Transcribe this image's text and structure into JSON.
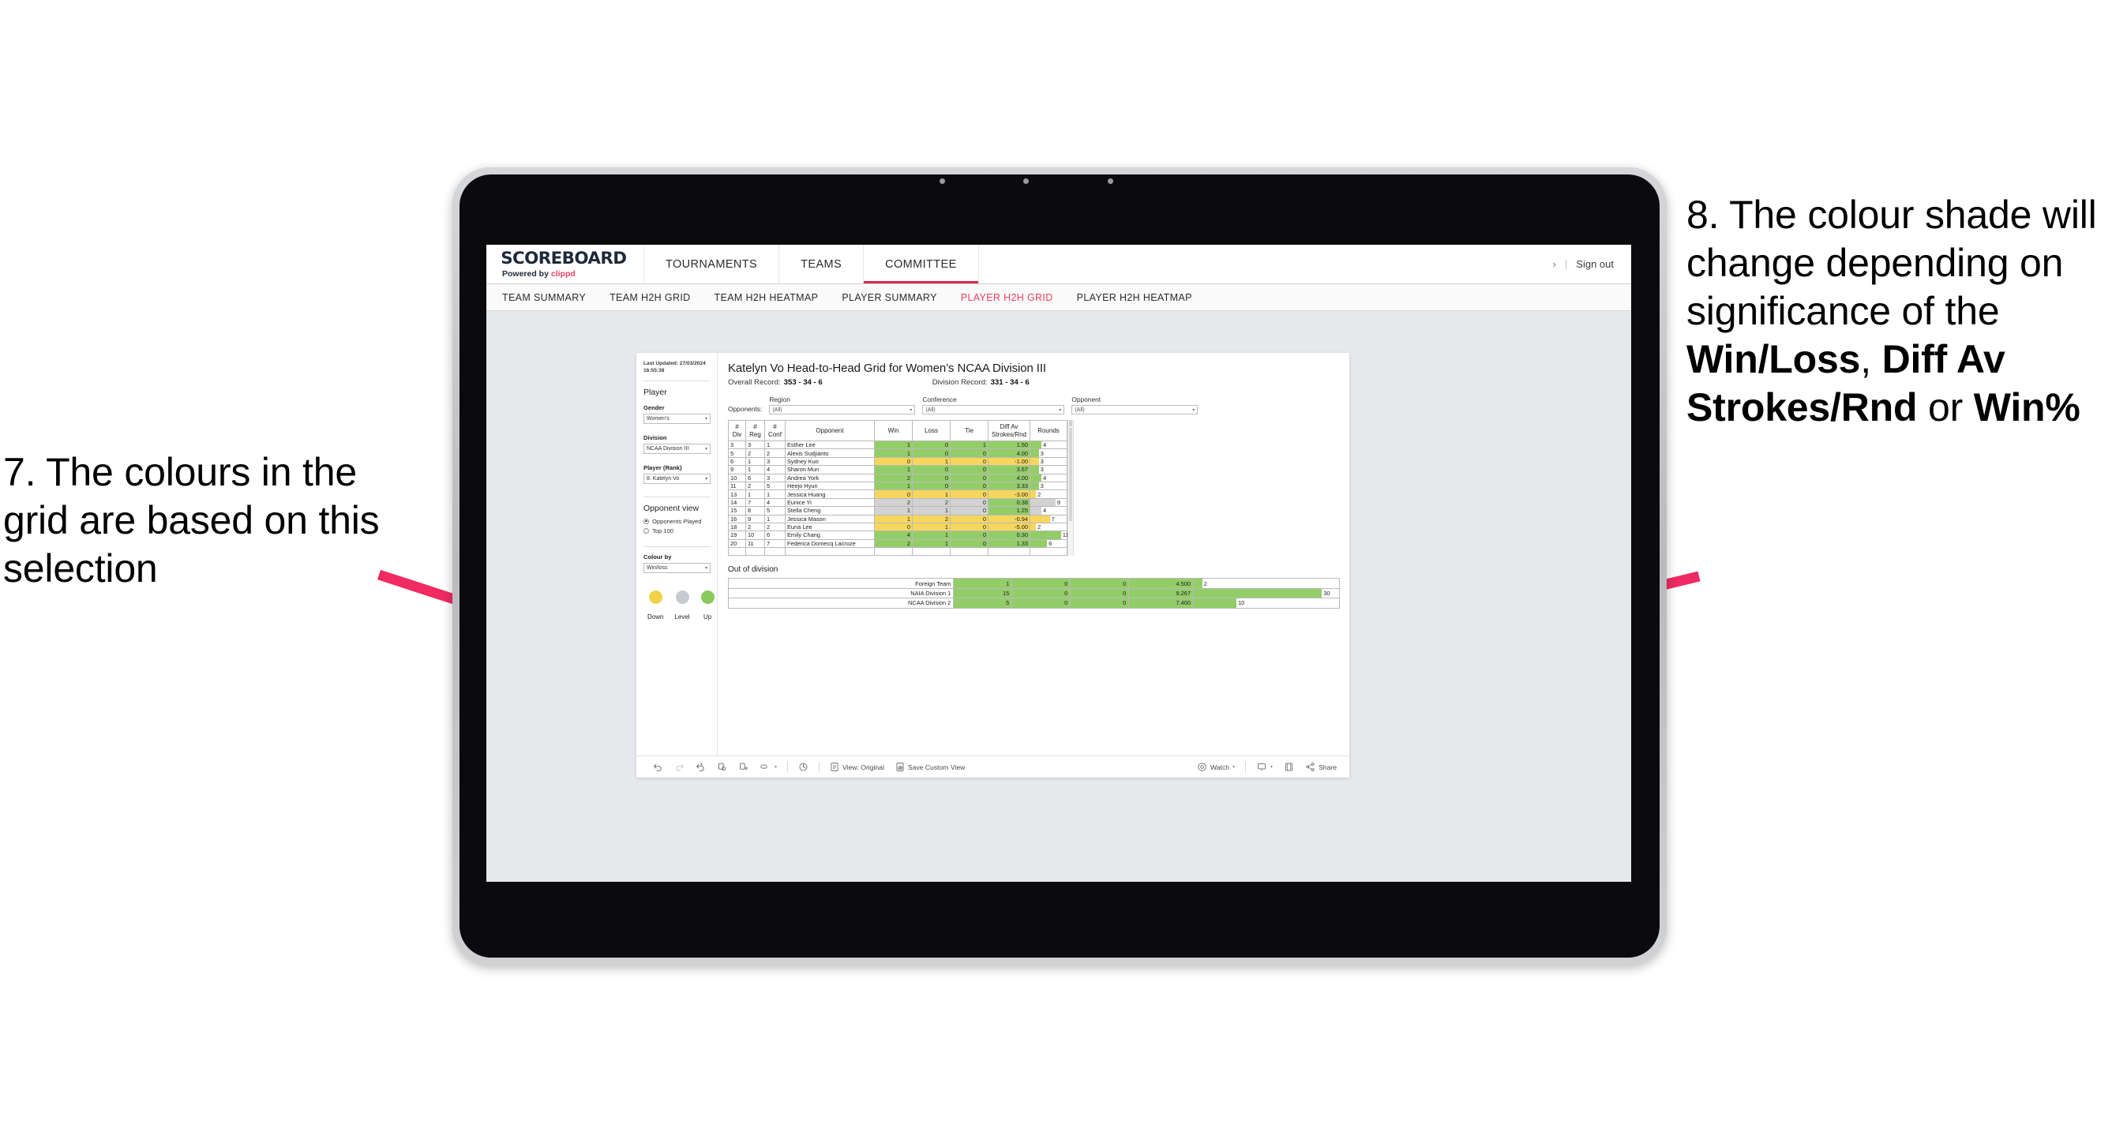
{
  "annotations": {
    "left": "7. The colours in the grid are based on this selection",
    "right_prefix": "8. The colour shade will change depending on significance of the ",
    "right_bold1": "Win/Loss",
    "right_mid1": ", ",
    "right_bold2": "Diff Av Strokes/Rnd",
    "right_mid2": " or ",
    "right_bold3": "Win%",
    "arrow_color": "#ed २१"
  },
  "colors": {
    "accent": "#e8415f",
    "arrow": "#ef2b62",
    "up": "#8bc95a",
    "level": "#c6cbd0",
    "down": "#f2d24b",
    "green_cell": "#93cd68",
    "yellow_cell": "#f6d65c",
    "grey_cell": "#d2d2d2"
  },
  "brand": {
    "title": "SCOREBOARD",
    "powered_prefix": "Powered by ",
    "powered_name": "clippd"
  },
  "topnav": {
    "tabs": [
      {
        "label": "TOURNAMENTS",
        "active": false
      },
      {
        "label": "TEAMS",
        "active": false
      },
      {
        "label": "COMMITTEE",
        "active": true
      }
    ],
    "chevron": "›",
    "divider": "|",
    "signout": "Sign out"
  },
  "subnav": {
    "tabs": [
      {
        "label": "TEAM SUMMARY",
        "active": false
      },
      {
        "label": "TEAM H2H GRID",
        "active": false
      },
      {
        "label": "TEAM H2H HEATMAP",
        "active": false
      },
      {
        "label": "PLAYER SUMMARY",
        "active": false
      },
      {
        "label": "PLAYER H2H GRID",
        "active": true
      },
      {
        "label": "PLAYER H2H HEATMAP",
        "active": false
      }
    ]
  },
  "filters": {
    "last_updated": "Last Updated: 27/03/2024 16:55:38",
    "section_title": "Player",
    "gender": {
      "label": "Gender",
      "value": "Women’s"
    },
    "division": {
      "label": "Division",
      "value": "NCAA Division III"
    },
    "player_rank": {
      "label": "Player (Rank)",
      "value": "8. Katelyn Vo"
    },
    "opponent_view": {
      "title": "Opponent view",
      "options": [
        {
          "label": "Opponents Played",
          "selected": true
        },
        {
          "label": "Top 100",
          "selected": false
        }
      ]
    },
    "colour_by": {
      "label": "Colour by",
      "value": "Win/loss"
    },
    "legend": [
      {
        "label": "Down",
        "color": "#f2d24b"
      },
      {
        "label": "Level",
        "color": "#c6cbd0"
      },
      {
        "label": "Up",
        "color": "#8bc95a"
      }
    ]
  },
  "viz": {
    "title": "Katelyn Vo Head-to-Head Grid for Women’s NCAA Division III",
    "overall_record_label": "Overall Record:",
    "overall_record_value": "353 -  34 - 6",
    "division_record_label": "Division Record:",
    "division_record_value": "331 -  34 - 6",
    "opponents_label": "Opponents:",
    "opponent_filters": [
      {
        "caption": "Region",
        "value": "(All)"
      },
      {
        "caption": "Conference",
        "value": "(All)"
      },
      {
        "caption": "Opponent",
        "value": "(All)"
      }
    ],
    "out_of_division_title": "Out of division"
  },
  "chart_data": {
    "type": "table",
    "title": "Katelyn Vo Head-to-Head Grid for Women’s NCAA Division III",
    "columns": [
      "# Div",
      "# Reg",
      "# Conf",
      "Opponent",
      "Win",
      "Loss",
      "Tie",
      "Diff Av Strokes/Rnd",
      "Rounds"
    ],
    "column_headers_two_line": [
      {
        "l1": "#",
        "l2": "Div"
      },
      {
        "l1": "#",
        "l2": "Reg"
      },
      {
        "l1": "#",
        "l2": "Conf"
      },
      {
        "l1": "Opponent",
        "l2": ""
      },
      {
        "l1": "Win",
        "l2": ""
      },
      {
        "l1": "Loss",
        "l2": ""
      },
      {
        "l1": "Tie",
        "l2": ""
      },
      {
        "l1": "Diff Av",
        "l2": "Strokes/Rnd"
      },
      {
        "l1": "Rounds",
        "l2": ""
      }
    ],
    "rounds_max": 13,
    "rows": [
      {
        "div": "3",
        "reg": "3",
        "conf": "1",
        "opponent": "Esther Lee",
        "win": "1",
        "loss": "0",
        "tie": "1",
        "diff": "1.50",
        "rounds": "4",
        "rounds_n": 4,
        "shade": "green"
      },
      {
        "div": "5",
        "reg": "2",
        "conf": "2",
        "opponent": "Alexis Sudjianto",
        "win": "1",
        "loss": "0",
        "tie": "0",
        "diff": "4.00",
        "rounds": "3",
        "rounds_n": 3,
        "shade": "green"
      },
      {
        "div": "6",
        "reg": "1",
        "conf": "3",
        "opponent": "Sydney Kuo",
        "win": "0",
        "loss": "1",
        "tie": "0",
        "diff": "-1.00",
        "rounds": "3",
        "rounds_n": 3,
        "shade": "yellow"
      },
      {
        "div": "9",
        "reg": "1",
        "conf": "4",
        "opponent": "Sharon Mun",
        "win": "1",
        "loss": "0",
        "tie": "0",
        "diff": "3.67",
        "rounds": "3",
        "rounds_n": 3,
        "shade": "green"
      },
      {
        "div": "10",
        "reg": "6",
        "conf": "3",
        "opponent": "Andrea York",
        "win": "2",
        "loss": "0",
        "tie": "0",
        "diff": "4.00",
        "rounds": "4",
        "rounds_n": 4,
        "shade": "green"
      },
      {
        "div": "11",
        "reg": "2",
        "conf": "5",
        "opponent": "Heejo Hyun",
        "win": "1",
        "loss": "0",
        "tie": "0",
        "diff": "3.33",
        "rounds": "3",
        "rounds_n": 3,
        "shade": "green"
      },
      {
        "div": "13",
        "reg": "1",
        "conf": "1",
        "opponent": "Jessica Huang",
        "win": "0",
        "loss": "1",
        "tie": "0",
        "diff": "-3.00",
        "rounds": "2",
        "rounds_n": 2,
        "shade": "yellow"
      },
      {
        "div": "14",
        "reg": "7",
        "conf": "4",
        "opponent": "Eunice Yi",
        "win": "2",
        "loss": "2",
        "tie": "0",
        "diff": "0.38",
        "rounds": "9",
        "rounds_n": 9,
        "shade": "grey",
        "diff_shade": "green"
      },
      {
        "div": "15",
        "reg": "8",
        "conf": "5",
        "opponent": "Stella Cheng",
        "win": "1",
        "loss": "1",
        "tie": "0",
        "diff": "1.25",
        "rounds": "4",
        "rounds_n": 4,
        "shade": "grey",
        "diff_shade": "green"
      },
      {
        "div": "16",
        "reg": "9",
        "conf": "1",
        "opponent": "Jessica Mason",
        "win": "1",
        "loss": "2",
        "tie": "0",
        "diff": "-0.94",
        "rounds": "7",
        "rounds_n": 7,
        "shade": "yellow"
      },
      {
        "div": "18",
        "reg": "2",
        "conf": "2",
        "opponent": "Euna Lee",
        "win": "0",
        "loss": "1",
        "tie": "0",
        "diff": "-5.00",
        "rounds": "2",
        "rounds_n": 2,
        "shade": "yellow"
      },
      {
        "div": "19",
        "reg": "10",
        "conf": "6",
        "opponent": "Emily Chang",
        "win": "4",
        "loss": "1",
        "tie": "0",
        "diff": "0.30",
        "rounds": "11",
        "rounds_n": 11,
        "shade": "green"
      },
      {
        "div": "20",
        "reg": "11",
        "conf": "7",
        "opponent": "Federica Domecq Lacroze",
        "win": "2",
        "loss": "1",
        "tie": "0",
        "diff": "1.33",
        "rounds": "6",
        "rounds_n": 6,
        "shade": "green"
      }
    ],
    "out_of_division": {
      "title": "Out of division",
      "rounds_max": 34,
      "rows": [
        {
          "name": "Foreign Team",
          "win": "1",
          "loss": "0",
          "tie": "0",
          "diff": "4.500",
          "rounds": "2",
          "rounds_n": 2,
          "shade": "green"
        },
        {
          "name": "NAIA Division 1",
          "win": "15",
          "loss": "0",
          "tie": "0",
          "diff": "9.267",
          "rounds": "30",
          "rounds_n": 30,
          "shade": "green"
        },
        {
          "name": "NCAA Division 2",
          "win": "5",
          "loss": "0",
          "tie": "0",
          "diff": "7.400",
          "rounds": "10",
          "rounds_n": 10,
          "shade": "green"
        }
      ]
    }
  },
  "toolbar": {
    "undo": "undo-icon",
    "redo": "redo-icon",
    "revert": "revert-icon",
    "refresh": "refresh-data-icon",
    "pause": "pause-icon",
    "highlight": "highlight-icon",
    "view_original_label": "View: Original",
    "save_custom_view_label": "Save Custom View",
    "watch_label": "Watch",
    "share_label": "Share"
  }
}
